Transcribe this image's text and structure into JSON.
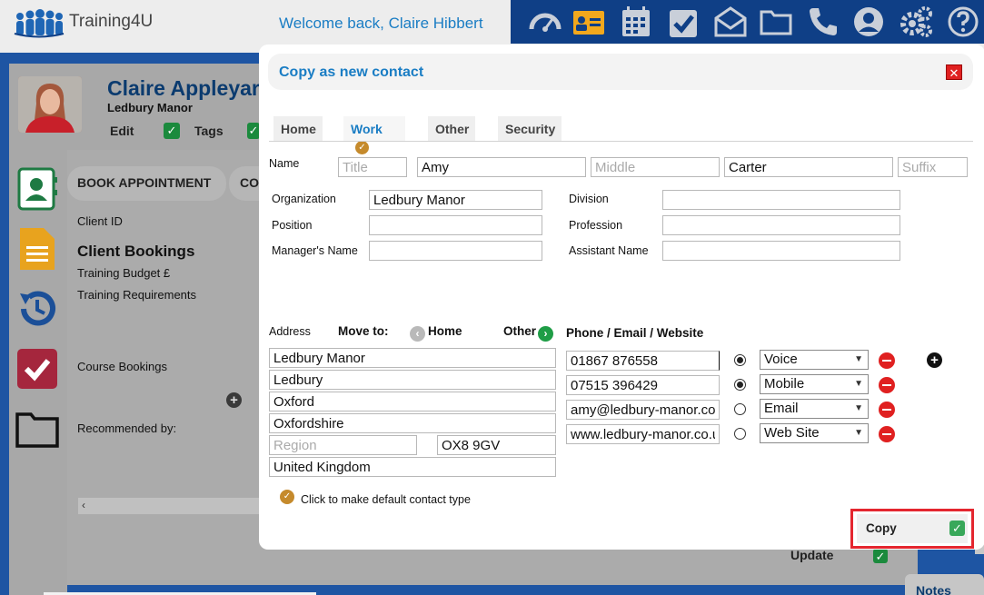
{
  "app": {
    "brand": "Training4U",
    "welcome": "Welcome back, Claire Hibbert",
    "toolbar_icons": [
      "dashboard-icon",
      "contacts-icon",
      "calendar-icon",
      "tasks-icon",
      "mail-icon",
      "folder-icon",
      "phone-icon",
      "user-icon",
      "settings-icon",
      "help-icon"
    ]
  },
  "background": {
    "contact_name": "Claire Appleyard",
    "organization": "Ledbury Manor",
    "edit_label": "Edit",
    "tags_label": "Tags",
    "book_appointment": "BOOK APPOINTMENT",
    "cou_tab": "COU",
    "client_id_label": "Client ID",
    "client_bookings": "Client Bookings",
    "training_budget": "Training Budget £",
    "training_requirements": "Training Requirements",
    "course_bookings": "Course Bookings",
    "recommended_by": "Recommended by:",
    "update_label": "Update",
    "notes_label": "Notes"
  },
  "modal": {
    "title": "Copy as new contact",
    "tabs": [
      {
        "label": "Home",
        "active": false
      },
      {
        "label": "Work",
        "active": true
      },
      {
        "label": "Other",
        "active": false
      },
      {
        "label": "Security",
        "active": false
      }
    ],
    "name": {
      "label": "Name",
      "title_placeholder": "Title",
      "first": "Amy",
      "middle_placeholder": "Middle",
      "last": "Carter",
      "suffix_placeholder": "Suffix"
    },
    "work": {
      "organization_label": "Organization",
      "organization": "Ledbury Manor",
      "position_label": "Position",
      "position": "",
      "managers_name_label": "Manager's Name",
      "managers_name": "",
      "division_label": "Division",
      "division": "",
      "profession_label": "Profession",
      "profession": "",
      "assistant_name_label": "Assistant Name",
      "assistant_name": ""
    },
    "address": {
      "label": "Address",
      "move_to_label": "Move to:",
      "move_home": "Home",
      "move_other": "Other",
      "line1": "Ledbury Manor",
      "line2": "Ledbury",
      "city": "Oxford",
      "county": "Oxfordshire",
      "region_placeholder": "Region",
      "postcode": "OX8 9GV",
      "country": "United Kingdom"
    },
    "contact_methods": {
      "heading": "Phone / Email / Website",
      "rows": [
        {
          "value": "01867 876558",
          "type": "Voice",
          "default": true
        },
        {
          "value": "07515 396429",
          "type": "Mobile",
          "default": true
        },
        {
          "value": "amy@ledbury-manor.co.",
          "type": "Email",
          "default": false
        },
        {
          "value": "www.ledbury-manor.co.u",
          "type": "Web Site",
          "default": false
        }
      ]
    },
    "default_hint": "Click to make default contact type",
    "copy_label": "Copy"
  },
  "colors": {
    "accent_blue": "#1a7dc4",
    "navy": "#0f3f86",
    "remove_red": "#e02020",
    "highlight_red": "#e4262f",
    "check_green": "#39a85a"
  }
}
